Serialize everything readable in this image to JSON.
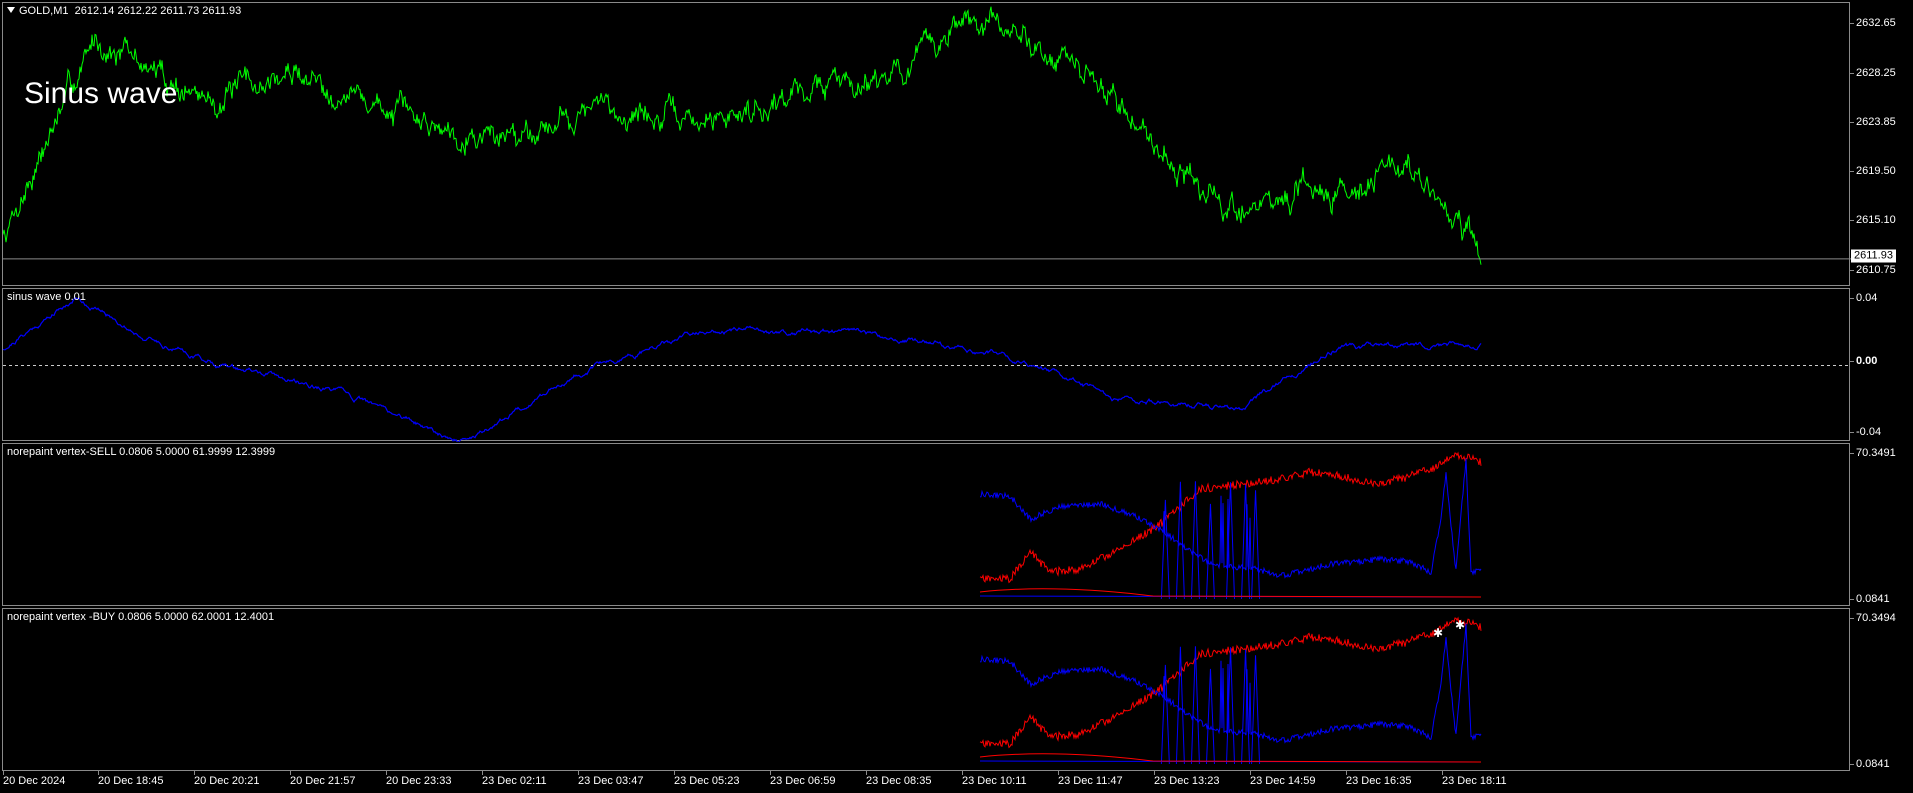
{
  "header": {
    "symbol": "GOLD,M1",
    "ohlc": "2612.14 2612.22 2611.73 2611.93"
  },
  "main": {
    "overlay_label": "Sinus wave",
    "current_price": "2611.93",
    "current_price_value": 2611.93,
    "y_ticks": [
      "2632.65",
      "2628.25",
      "2623.85",
      "2619.50",
      "2615.10",
      "2610.75"
    ],
    "color": "#00ff00"
  },
  "sinus": {
    "label": "sinus wave 0.01",
    "y_ticks": [
      "0.04",
      "0.00",
      "-0.04"
    ],
    "color": "#0000ff"
  },
  "sell": {
    "label": "norepaint vertex-SELL 0.0806 5.0000 61.9999 12.3999",
    "y_ticks": [
      "70.3491",
      "0.0841"
    ]
  },
  "buy": {
    "label": "norepaint vertex -BUY 0.0806 5.0000 62.0001 12.4001",
    "y_ticks": [
      "70.3494",
      "0.0841"
    ]
  },
  "x_ticks": [
    "20 Dec 2024",
    "20 Dec 18:45",
    "20 Dec 20:21",
    "20 Dec 21:57",
    "20 Dec 23:33",
    "23 Dec 02:11",
    "23 Dec 03:47",
    "23 Dec 05:23",
    "23 Dec 06:59",
    "23 Dec 08:35",
    "23 Dec 10:11",
    "23 Dec 11:47",
    "23 Dec 13:23",
    "23 Dec 14:59",
    "23 Dec 16:35",
    "23 Dec 18:11"
  ],
  "colors": {
    "red": "#ff0000",
    "blue": "#0000ff",
    "green": "#00ff00",
    "grid": "#8a8a8a"
  },
  "chart_data": [
    {
      "type": "line",
      "title": "",
      "series": [
        {
          "name": "",
          "x": [
            0,
            0.05,
            0.11,
            0.16,
            0.22,
            0.27,
            0.32,
            0.38,
            0.43,
            0.49,
            0.52,
            0.56,
            0.6,
            0.66,
            0.71,
            0.76,
            0.8
          ],
          "values": [
            2614.0,
            2631.0,
            2625.5,
            2628.0,
            2624.0,
            2622.5,
            2625.0,
            2623.5,
            2626.5,
            2628.5,
            2632.5,
            2630.5,
            2626.0,
            2616.0,
            2617.5,
            2620.0,
            2611.93
          ]
        }
      ],
      "ylim": [
        2609.5,
        2634.0
      ],
      "grid": false
    },
    {
      "type": "line",
      "title": "",
      "series": [
        {
          "name": "",
          "x": [
            0,
            0.04,
            0.08,
            0.12,
            0.18,
            0.25,
            0.31,
            0.38,
            0.46,
            0.55,
            0.6,
            0.67,
            0.72,
            0.8
          ],
          "values": [
            0.01,
            0.04,
            0.015,
            0.0,
            -0.015,
            -0.045,
            -0.005,
            0.02,
            0.02,
            0.005,
            -0.02,
            -0.025,
            0.01,
            0.012
          ]
        }
      ],
      "ylim": [
        -0.045,
        0.045
      ],
      "grid": false
    }
  ]
}
